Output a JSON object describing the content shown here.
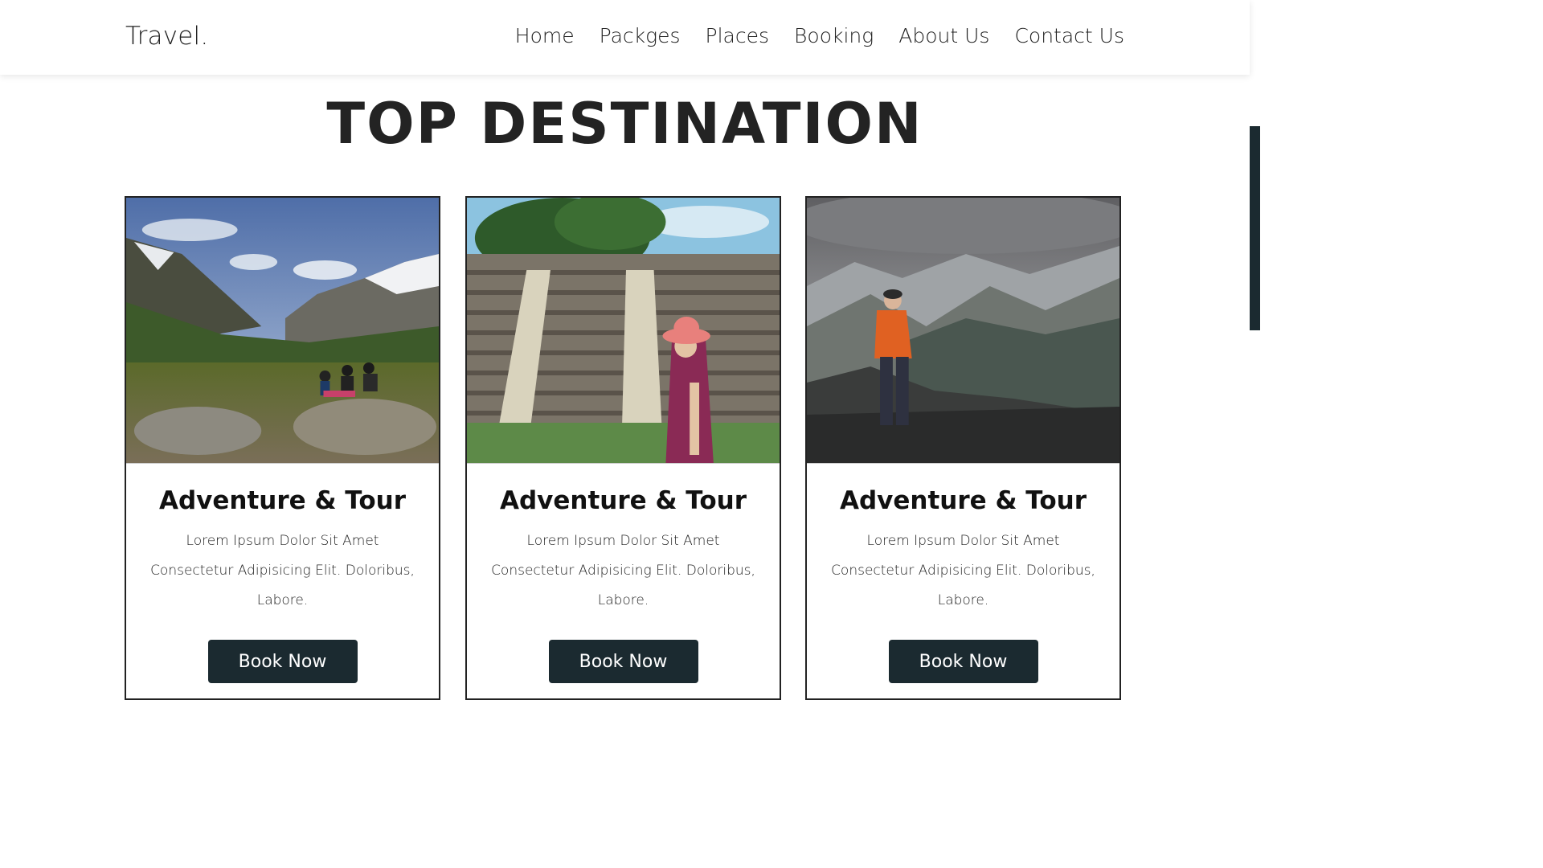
{
  "header": {
    "logo": "Travel.",
    "nav": [
      "Home",
      "Packges",
      "Places",
      "Booking",
      "About Us",
      "Contact Us"
    ]
  },
  "section": {
    "title": "TOP DESTINATION"
  },
  "cards": [
    {
      "image": "mountain-valley-picnic-photo",
      "title": "Adventure & Tour",
      "description": "Lorem Ipsum Dolor Sit Amet Consectetur Adipisicing Elit. Doloribus, Labore.",
      "button": "Book Now"
    },
    {
      "image": "ancient-pyramid-traveler-photo",
      "title": "Adventure & Tour",
      "description": "Lorem Ipsum Dolor Sit Amet Consectetur Adipisicing Elit. Doloribus, Labore.",
      "button": "Book Now"
    },
    {
      "image": "hiker-mountain-peak-photo",
      "title": "Adventure & Tour",
      "description": "Lorem Ipsum Dolor Sit Amet Consectetur Adipisicing Elit. Doloribus, Labore.",
      "button": "Book Now"
    }
  ],
  "colors": {
    "button_bg": "#1b2a30",
    "title_text": "#232323",
    "scrollbar_thumb": "#1b2a30"
  }
}
